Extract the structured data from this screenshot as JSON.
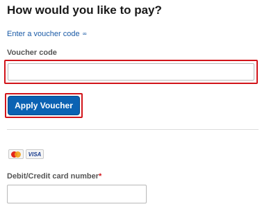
{
  "heading": "How would you like to pay?",
  "voucher": {
    "toggle_label": "Enter a voucher code",
    "field_label": "Voucher code",
    "value": "",
    "apply_label": "Apply Voucher"
  },
  "card": {
    "brands": [
      "mastercard-icon",
      "visa-icon"
    ],
    "visa_text": "VISA",
    "field_label": "Debit/Credit card number",
    "required_mark": "*",
    "value": ""
  },
  "colors": {
    "link": "#1a5aa6",
    "button": "#0b62b3",
    "highlight": "#d2141a",
    "required": "#d2141a"
  }
}
